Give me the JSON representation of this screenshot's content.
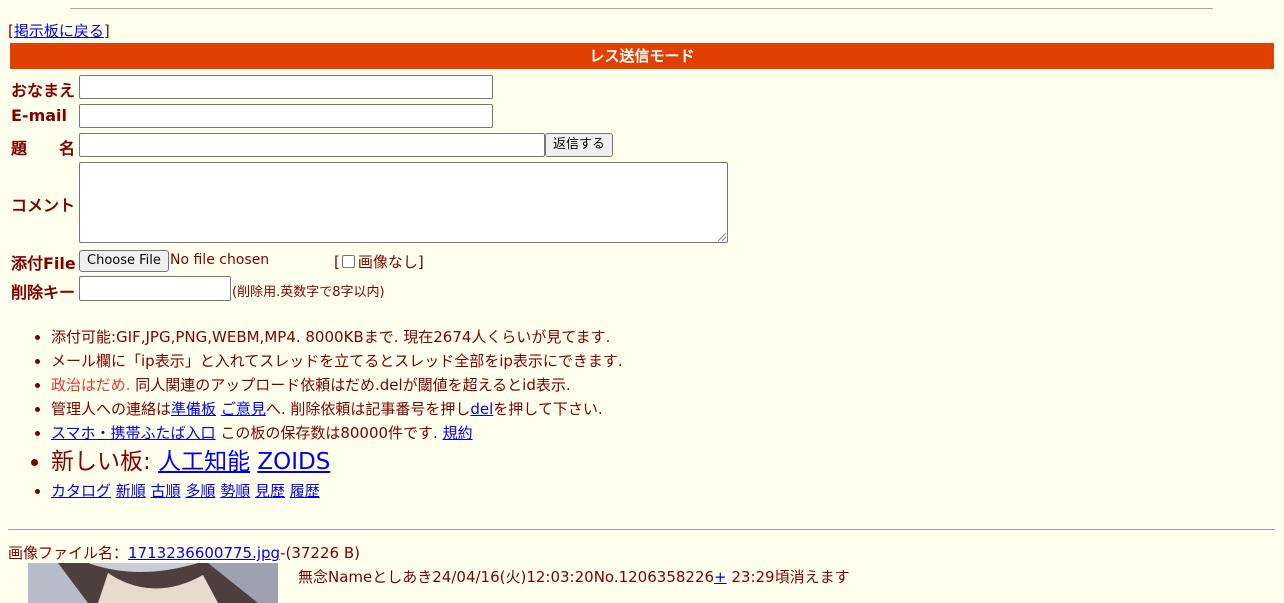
{
  "nav": {
    "bracket_open": "[",
    "back_link": "掲示板に戻る",
    "bracket_close": "]"
  },
  "mode_bar": "レス送信モード",
  "form": {
    "name_label": "おなまえ",
    "email_label": "E-mail",
    "subject_label": "題　　名",
    "submit_button": "返信する",
    "comment_label": "コメント",
    "file_label": "添付File",
    "choose_file_button": "Choose File",
    "no_file_text": "No file chosen",
    "no_image_open": "[",
    "no_image_label": "画像なし",
    "no_image_close": "]",
    "delete_key_label": "削除キー",
    "delete_key_hint": "(削除用.英数字で8字以内)"
  },
  "rules": {
    "line1": "添付可能:GIF,JPG,PNG,WEBM,MP4. 8000KBまで. 現在2674人くらいが見てます.",
    "line2": "メール欄に「ip表示」と入れてスレッドを立てるとスレッド全部をip表示にできます.",
    "line3_red": "政治はだめ.",
    "line3_rest": " 同人関連のアップロード依頼はだめ.delが閾値を超えるとid表示.",
    "line4_a": "管理人への連絡は",
    "line4_link1": "準備板",
    "line4_link2": "ご意見",
    "line4_b": "へ. 削除依頼は記事番号を押し",
    "line4_link3": "del",
    "line4_c": "を押して下さい.",
    "line5_link": "スマホ・携帯ふたば入口",
    "line5_text": " この板の保存数は80000件です. ",
    "line5_link2": "規約",
    "new_boards_label": "新しい板: ",
    "new_board1": "人工知能",
    "new_board2": "ZOIDS",
    "sort_links": [
      "カタログ",
      "新順",
      "古順",
      "多順",
      "勢順",
      "見歴",
      "履歴"
    ]
  },
  "post": {
    "file_label": "画像ファイル名：",
    "file_name": "1713236600775.jpg",
    "file_size": "-(37226 B)",
    "header": "無念Nameとしあき24/04/16(火)12:03:20No.1206358226",
    "plus_link": "+",
    "expire": " 23:29頃消えます"
  }
}
